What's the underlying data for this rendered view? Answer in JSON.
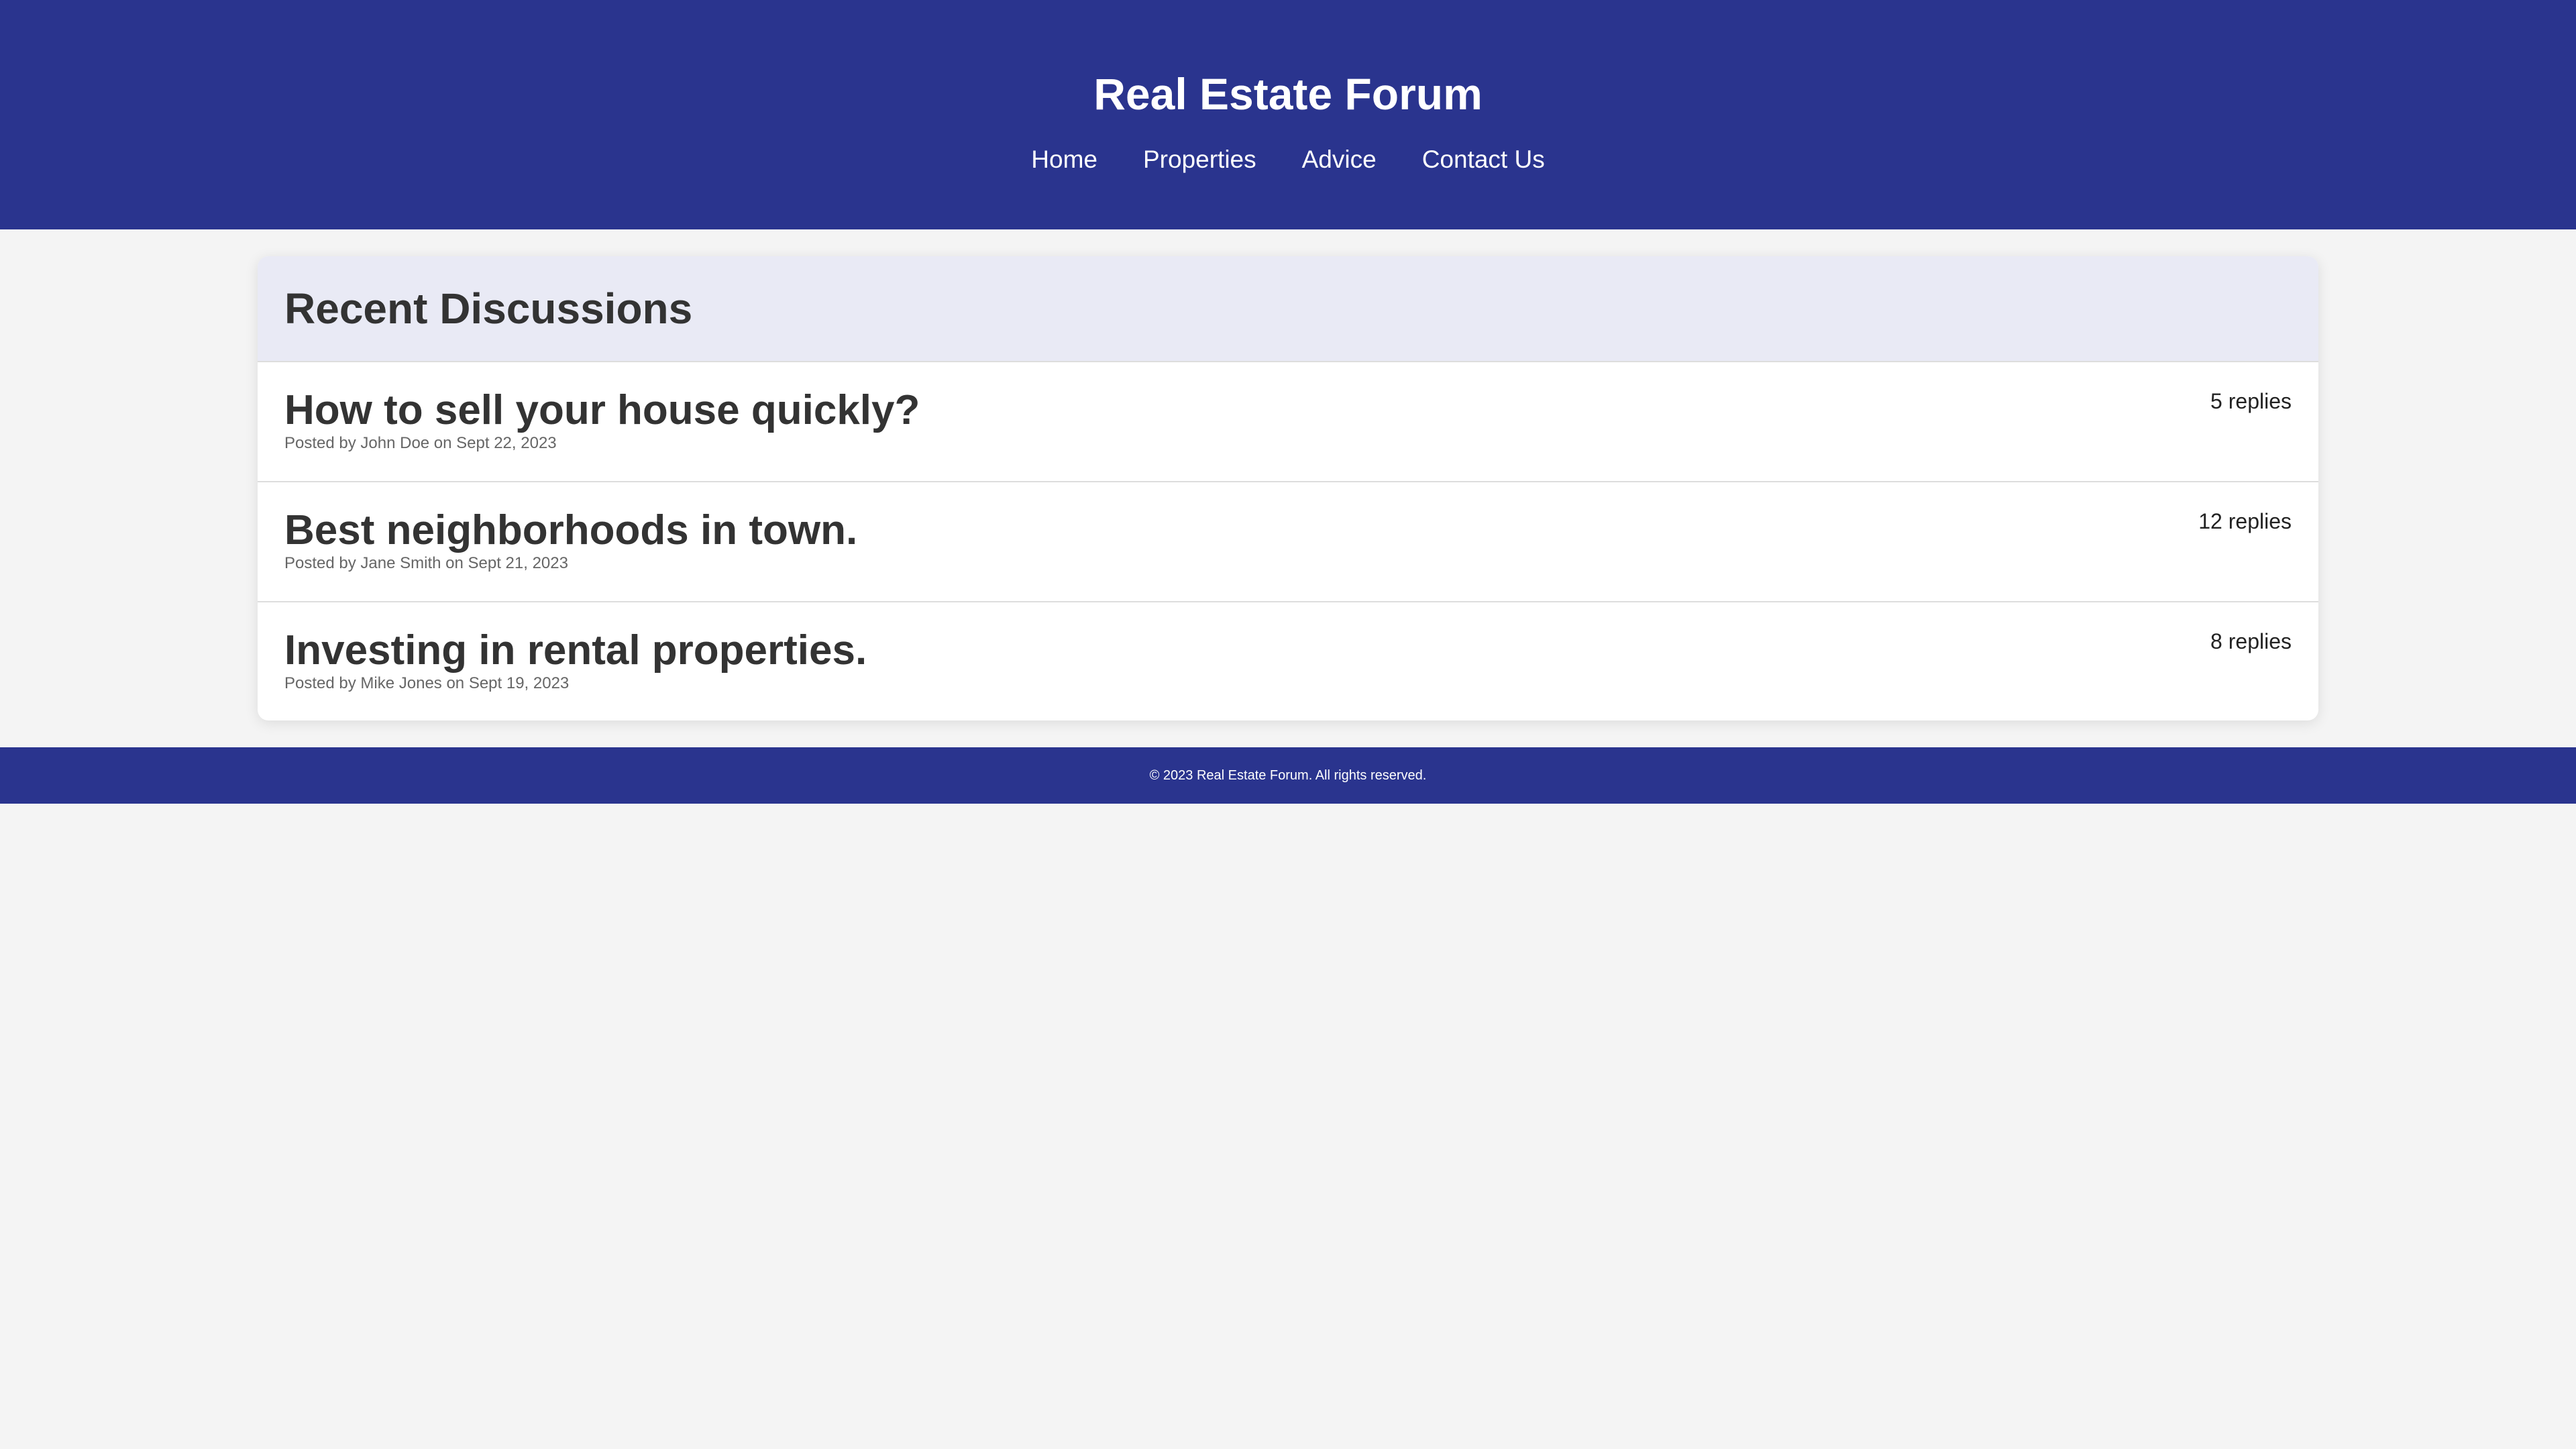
{
  "header": {
    "title": "Real Estate Forum",
    "nav": [
      {
        "label": "Home"
      },
      {
        "label": "Properties"
      },
      {
        "label": "Advice"
      },
      {
        "label": "Contact Us"
      }
    ]
  },
  "main": {
    "section_title": "Recent Discussions",
    "discussions": [
      {
        "title": "How to sell your house quickly?",
        "meta": "Posted by John Doe on Sept 22, 2023",
        "replies": "5 replies"
      },
      {
        "title": "Best neighborhoods in town.",
        "meta": "Posted by Jane Smith on Sept 21, 2023",
        "replies": "12 replies"
      },
      {
        "title": "Investing in rental properties.",
        "meta": "Posted by Mike Jones on Sept 19, 2023",
        "replies": "8 replies"
      }
    ]
  },
  "footer": {
    "text": "© 2023 Real Estate Forum. All rights reserved."
  },
  "colors": {
    "brand": "#2a348e",
    "section_header_bg": "#e9eaf5",
    "page_bg": "#f4f4f4"
  }
}
